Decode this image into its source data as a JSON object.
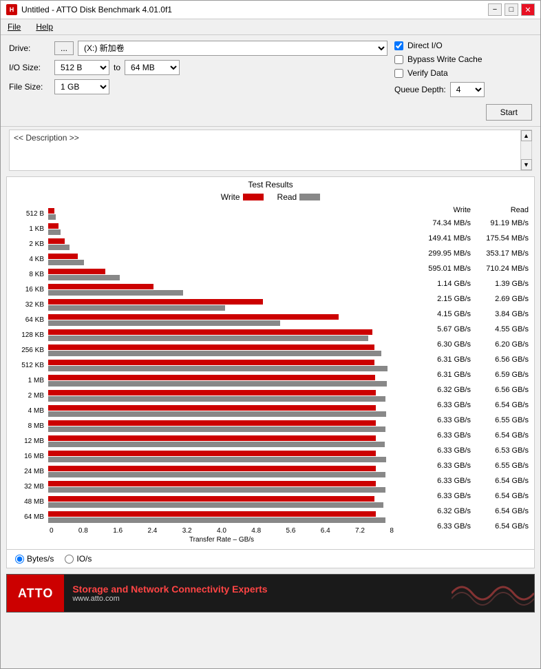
{
  "window": {
    "title": "Untitled - ATTO Disk Benchmark 4.01.0f1",
    "icon": "HDD"
  },
  "menu": {
    "file_label": "File",
    "file_underline": "F",
    "help_label": "Help",
    "help_underline": "H"
  },
  "toolbar": {
    "drive_label": "Drive:",
    "drive_btn_label": "...",
    "drive_value": "(X:) 新加卷",
    "io_size_label": "I/O Size:",
    "io_from": "512 B",
    "io_to_label": "to",
    "io_to": "64 MB",
    "file_size_label": "File Size:",
    "file_size_value": "1 GB",
    "direct_io_label": "Direct I/O",
    "bypass_write_cache_label": "Bypass Write Cache",
    "verify_data_label": "Verify Data",
    "queue_depth_label": "Queue Depth:",
    "queue_depth_value": "4",
    "start_label": "Start"
  },
  "description": {
    "placeholder": "<< Description >>"
  },
  "chart": {
    "title": "Test Results",
    "write_legend": "Write",
    "read_legend": "Read",
    "x_axis_title": "Transfer Rate – GB/s",
    "x_labels": [
      "0",
      "0.8",
      "1.6",
      "2.4",
      "3.2",
      "4.0",
      "4.8",
      "5.6",
      "6.4",
      "7.2",
      "8"
    ],
    "rows": [
      {
        "label": "512 B",
        "write_pct": 1.5,
        "read_pct": 1.8
      },
      {
        "label": "1 KB",
        "write_pct": 2.5,
        "read_pct": 3.0
      },
      {
        "label": "2 KB",
        "write_pct": 4.0,
        "read_pct": 5.0
      },
      {
        "label": "4 KB",
        "write_pct": 7.0,
        "read_pct": 8.5
      },
      {
        "label": "8 KB",
        "write_pct": 13.5,
        "read_pct": 17.0
      },
      {
        "label": "16 KB",
        "write_pct": 25.0,
        "read_pct": 32.0
      },
      {
        "label": "32 KB",
        "write_pct": 51.0,
        "read_pct": 42.0
      },
      {
        "label": "64 KB",
        "write_pct": 69.0,
        "read_pct": 55.0
      },
      {
        "label": "128 KB",
        "write_pct": 77.0,
        "read_pct": 76.0
      },
      {
        "label": "256 KB",
        "write_pct": 77.5,
        "read_pct": 79.0
      },
      {
        "label": "512 KB",
        "write_pct": 77.5,
        "read_pct": 80.5
      },
      {
        "label": "1 MB",
        "write_pct": 77.6,
        "read_pct": 80.3
      },
      {
        "label": "2 MB",
        "write_pct": 77.7,
        "read_pct": 80.0
      },
      {
        "label": "4 MB",
        "write_pct": 77.7,
        "read_pct": 80.2
      },
      {
        "label": "8 MB",
        "write_pct": 77.7,
        "read_pct": 80.0
      },
      {
        "label": "12 MB",
        "write_pct": 77.7,
        "read_pct": 79.8
      },
      {
        "label": "16 MB",
        "write_pct": 77.7,
        "read_pct": 80.2
      },
      {
        "label": "24 MB",
        "write_pct": 77.7,
        "read_pct": 80.0
      },
      {
        "label": "32 MB",
        "write_pct": 77.7,
        "read_pct": 80.0
      },
      {
        "label": "48 MB",
        "write_pct": 77.5,
        "read_pct": 79.5
      },
      {
        "label": "64 MB",
        "write_pct": 77.7,
        "read_pct": 80.0
      }
    ]
  },
  "data_table": {
    "write_header": "Write",
    "read_header": "Read",
    "rows": [
      {
        "write": "74.34 MB/s",
        "read": "91.19 MB/s"
      },
      {
        "write": "149.41 MB/s",
        "read": "175.54 MB/s"
      },
      {
        "write": "299.95 MB/s",
        "read": "353.17 MB/s"
      },
      {
        "write": "595.01 MB/s",
        "read": "710.24 MB/s"
      },
      {
        "write": "1.14 GB/s",
        "read": "1.39 GB/s"
      },
      {
        "write": "2.15 GB/s",
        "read": "2.69 GB/s"
      },
      {
        "write": "4.15 GB/s",
        "read": "3.84 GB/s"
      },
      {
        "write": "5.67 GB/s",
        "read": "4.55 GB/s"
      },
      {
        "write": "6.30 GB/s",
        "read": "6.20 GB/s"
      },
      {
        "write": "6.31 GB/s",
        "read": "6.56 GB/s"
      },
      {
        "write": "6.31 GB/s",
        "read": "6.59 GB/s"
      },
      {
        "write": "6.32 GB/s",
        "read": "6.56 GB/s"
      },
      {
        "write": "6.33 GB/s",
        "read": "6.54 GB/s"
      },
      {
        "write": "6.33 GB/s",
        "read": "6.55 GB/s"
      },
      {
        "write": "6.33 GB/s",
        "read": "6.54 GB/s"
      },
      {
        "write": "6.33 GB/s",
        "read": "6.53 GB/s"
      },
      {
        "write": "6.33 GB/s",
        "read": "6.55 GB/s"
      },
      {
        "write": "6.33 GB/s",
        "read": "6.54 GB/s"
      },
      {
        "write": "6.33 GB/s",
        "read": "6.54 GB/s"
      },
      {
        "write": "6.32 GB/s",
        "read": "6.54 GB/s"
      },
      {
        "write": "6.33 GB/s",
        "read": "6.54 GB/s"
      }
    ]
  },
  "bottom": {
    "bytes_s_label": "Bytes/s",
    "io_s_label": "IO/s",
    "bytes_s_selected": true
  },
  "footer": {
    "logo": "ATTO",
    "tagline": "Storage and Network Connectivity Experts",
    "url": "www.atto.com"
  }
}
